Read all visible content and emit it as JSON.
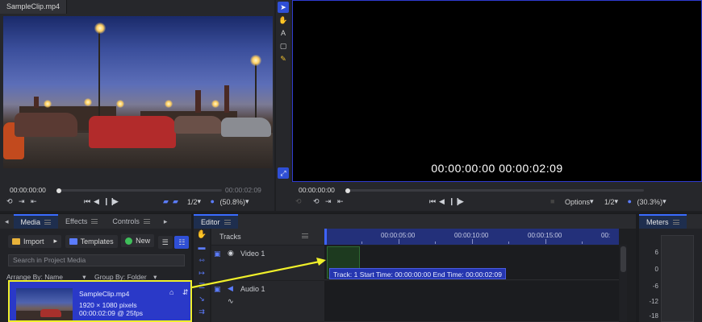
{
  "source_viewer": {
    "tab_label": "SampleClip.mp4",
    "timecode_in": "00:00:00:00",
    "timecode_out": "00:00:02:09",
    "quality": "1/2",
    "zoom": "(50.8%)"
  },
  "program_viewer": {
    "timecode_display": "00:00:00:00 00:00:02:09",
    "timecode_in": "00:00:00:00",
    "quality": "1/2",
    "zoom": "(30.3%)",
    "options_label": "Options"
  },
  "media_panel": {
    "tabs": [
      {
        "label": "Media",
        "active": true
      },
      {
        "label": "Effects",
        "active": false
      },
      {
        "label": "Controls",
        "active": false
      }
    ],
    "import_label": "Import",
    "templates_label": "Templates",
    "new_label": "New",
    "search_placeholder": "Search in Project Media",
    "arrange_label": "Arrange By: Name",
    "group_label": "Group By: Folder",
    "item": {
      "name": "SampleClip.mp4",
      "resolution": "1920 × 1080 pixels",
      "duration": "00:00:02:09 @ 25fps"
    }
  },
  "editor": {
    "tab_label": "Editor",
    "tracks_label": "Tracks",
    "ruler_labels": [
      "00:00:05:00",
      "00:00:10:00",
      "00:00:15:00",
      "00:"
    ],
    "video_track": "Video 1",
    "audio_track": "Audio 1",
    "tooltip": "Track: 1 Start Time: 00:00:00:00 End Time: 00:00:02:09"
  },
  "meters": {
    "tab_label": "Meters",
    "labels": [
      "6",
      "0",
      "-6",
      "-12",
      "-18"
    ]
  },
  "colors": {
    "accent": "#2f4fd6",
    "highlight": "#f0f02a",
    "panel": "#26272b"
  }
}
